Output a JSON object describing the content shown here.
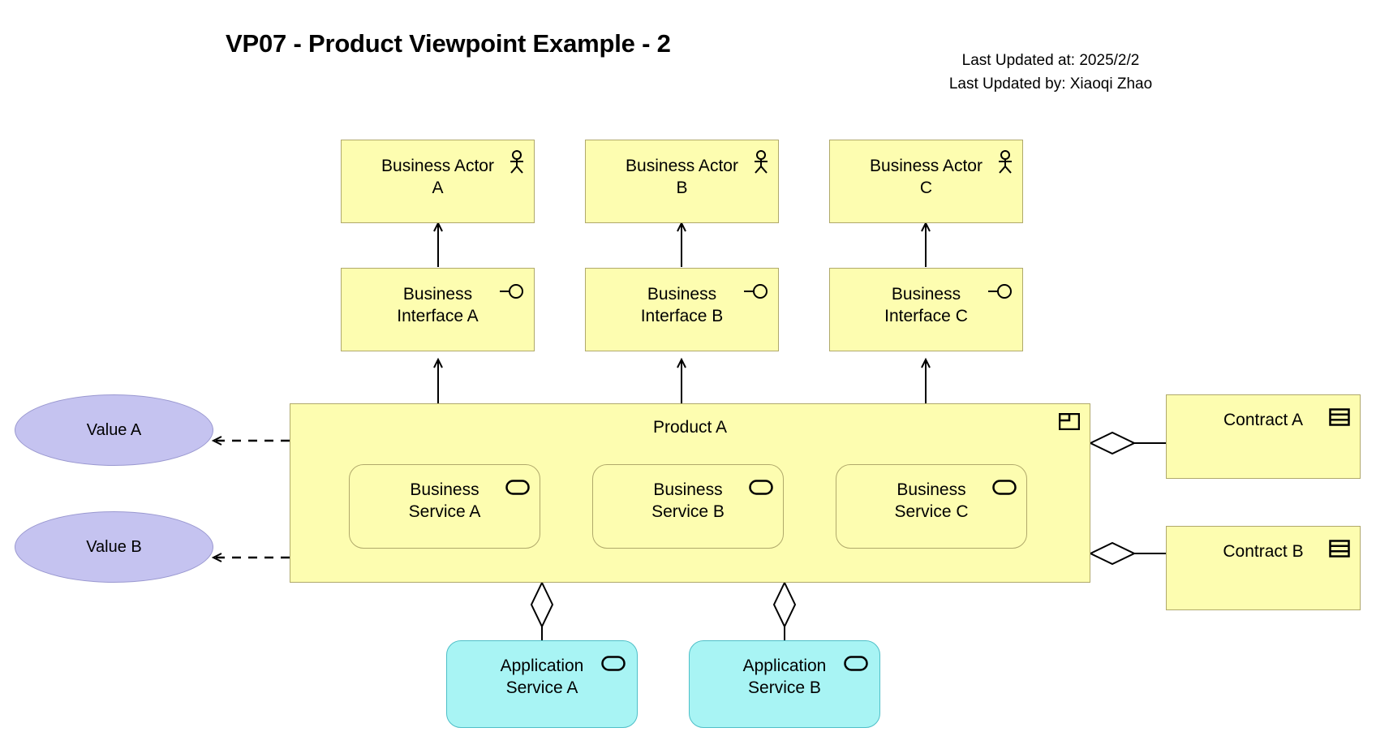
{
  "header": {
    "title": "VP07 - Product Viewpoint Example - 2",
    "last_updated_at": "Last Updated at: 2025/2/2",
    "last_updated_by": "Last Updated by: Xiaoqi Zhao"
  },
  "colors": {
    "business_fill": "#FDFDB0",
    "business_stroke": "#B0A96B",
    "application_fill": "#A8F4F4",
    "application_stroke": "#4FBFC8",
    "value_fill": "#C5C3F0",
    "value_stroke": "#9A98D0",
    "line": "#000000",
    "background": "#FFFFFF"
  },
  "nodes": {
    "actors": [
      {
        "label": "Business Actor\nA",
        "icon": "business-actor-icon"
      },
      {
        "label": "Business Actor\nB",
        "icon": "business-actor-icon"
      },
      {
        "label": "Business Actor\nC",
        "icon": "business-actor-icon"
      }
    ],
    "interfaces": [
      {
        "label": "Business\nInterface A",
        "icon": "business-interface-icon"
      },
      {
        "label": "Business\nInterface B",
        "icon": "business-interface-icon"
      },
      {
        "label": "Business\nInterface C",
        "icon": "business-interface-icon"
      }
    ],
    "product": {
      "label": "Product A",
      "icon": "product-icon"
    },
    "business_services": [
      {
        "label": "Business\nService A",
        "icon": "business-service-icon"
      },
      {
        "label": "Business\nService B",
        "icon": "business-service-icon"
      },
      {
        "label": "Business\nService C",
        "icon": "business-service-icon"
      }
    ],
    "application_services": [
      {
        "label": "Application\nService A",
        "icon": "application-service-icon"
      },
      {
        "label": "Application\nService B",
        "icon": "application-service-icon"
      }
    ],
    "values": [
      {
        "label": "Value A"
      },
      {
        "label": "Value B"
      }
    ],
    "contracts": [
      {
        "label": "Contract A",
        "icon": "contract-icon"
      },
      {
        "label": "Contract B",
        "icon": "contract-icon"
      }
    ]
  },
  "relationships": [
    {
      "type": "assignment-arrow",
      "from": "Business Interface A",
      "to": "Business Actor A"
    },
    {
      "type": "assignment-arrow",
      "from": "Business Interface B",
      "to": "Business Actor B"
    },
    {
      "type": "assignment-arrow",
      "from": "Business Interface C",
      "to": "Business Actor C"
    },
    {
      "type": "assignment-arrow",
      "from": "Product A",
      "to": "Business Interface A"
    },
    {
      "type": "assignment-arrow",
      "from": "Product A",
      "to": "Business Interface B"
    },
    {
      "type": "assignment-arrow",
      "from": "Product A",
      "to": "Business Interface C"
    },
    {
      "type": "realization-dashed-arrow",
      "from": "Product A",
      "to": "Value A"
    },
    {
      "type": "realization-dashed-arrow",
      "from": "Product A",
      "to": "Value B"
    },
    {
      "type": "aggregation",
      "from": "Product A",
      "to": "Contract A"
    },
    {
      "type": "aggregation",
      "from": "Product A",
      "to": "Contract B"
    },
    {
      "type": "aggregation",
      "from": "Product A",
      "to": "Application Service A"
    },
    {
      "type": "aggregation",
      "from": "Product A",
      "to": "Application Service B"
    }
  ]
}
